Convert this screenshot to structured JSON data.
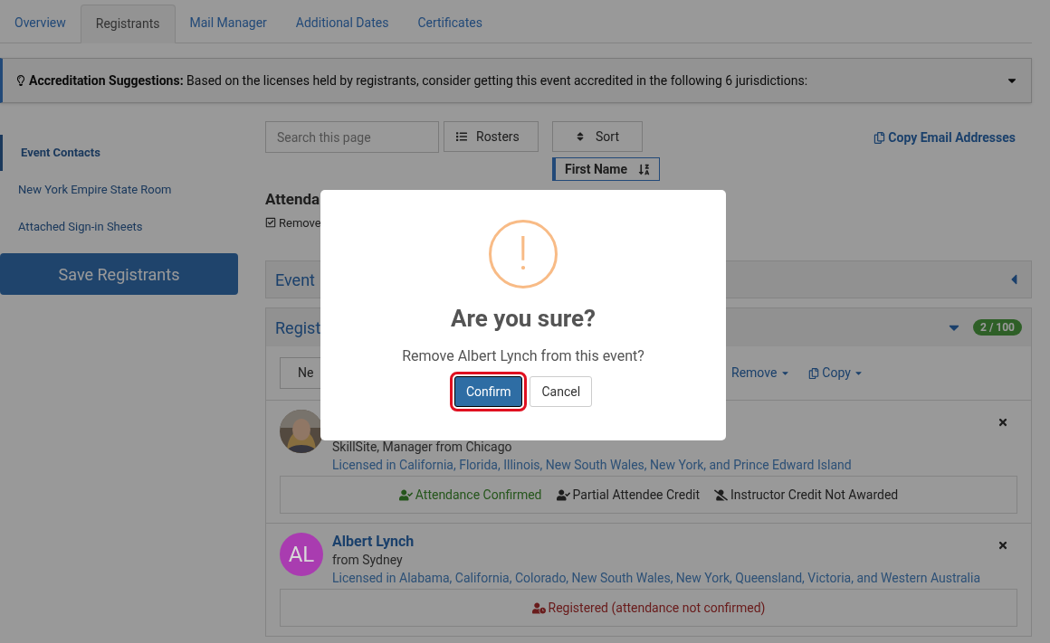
{
  "tabs": [
    {
      "label": "Overview",
      "selected": false
    },
    {
      "label": "Registrants",
      "selected": true
    },
    {
      "label": "Mail Manager",
      "selected": false
    },
    {
      "label": "Additional Dates",
      "selected": false
    },
    {
      "label": "Certificates",
      "selected": false
    }
  ],
  "banner": {
    "label": "Accreditation Suggestions:",
    "text": "Based on the licenses held by registrants, consider getting this event accredited in the following 6 jurisdictions:",
    "expanded": false
  },
  "sidebar": {
    "items": [
      {
        "label": "Event Contacts",
        "selected": true
      },
      {
        "label": "New York Empire State Room",
        "selected": false
      },
      {
        "label": "Attached Sign-in Sheets",
        "selected": false
      }
    ],
    "save_button": "Save Registrants"
  },
  "toolbar": {
    "search": {
      "placeholder": "Search this page"
    },
    "rosters": "Rosters",
    "sort": "Sort",
    "copy_emails": "Copy Email Addresses",
    "sort_chip": "First Name"
  },
  "heading": "Attenda",
  "checkbox": {
    "label": "Remove",
    "checked": true
  },
  "panels": [
    {
      "title": "Event",
      "expanded": false
    },
    {
      "title": "Regist",
      "expanded": true,
      "count": "2 / 100"
    }
  ],
  "actions": [
    "Ne",
    "Remove",
    "Copy"
  ],
  "registrants": [
    {
      "subtitle": "SkillSite, Manager from Chicago",
      "licenses": "Licensed in California, Florida, Illinois, New South Wales, New York, and Prince Edward Island",
      "statuses": [
        {
          "kind": "confirmed",
          "label": "Attendance Confirmed"
        },
        {
          "kind": "partial",
          "label": "Partial Attendee Credit"
        },
        {
          "kind": "not_awarded",
          "label": "Instructor Credit Not Awarded"
        }
      ]
    },
    {
      "name": "Albert Lynch",
      "avatar": {
        "kind": "initials",
        "initials": "AL",
        "color": "#a93cb0"
      },
      "subtitle": "from Sydney",
      "licenses": "Licensed in Alabama, California, Colorado, New South Wales, New York, Queensland, Victoria, and Western Australia",
      "statuses": [
        {
          "kind": "registered",
          "label": "Registered (attendance not confirmed)"
        }
      ]
    }
  ],
  "modal": {
    "icon": "!",
    "title": "Are you sure?",
    "message": "Remove Albert Lynch from this event?",
    "buttons": [
      {
        "label": "Confirm",
        "kind": "primary",
        "focused": true
      },
      {
        "label": "Cancel",
        "kind": "secondary",
        "focused": false
      }
    ]
  }
}
